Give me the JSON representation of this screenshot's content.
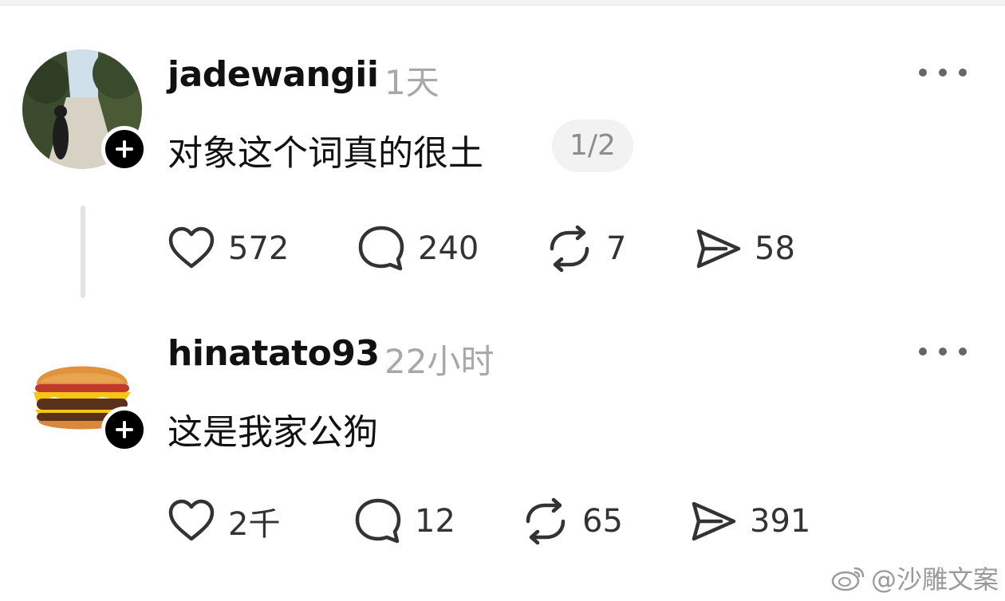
{
  "posts": [
    {
      "username": "jadewangii",
      "time": "1天",
      "content": "对象这个词真的很土",
      "page_badge": "1/2",
      "stats": {
        "likes": "572",
        "comments": "240",
        "reposts": "7",
        "shares": "58"
      }
    },
    {
      "username": "hinatato93",
      "time": "22小时",
      "content": "这是我家公狗",
      "stats": {
        "likes": "2千",
        "comments": "12",
        "reposts": "65",
        "shares": "391"
      }
    }
  ],
  "watermark": {
    "text": "@沙雕文案"
  },
  "icons": {
    "like": "heart-icon",
    "comment": "comment-bubble-icon",
    "repost": "repost-icon",
    "share": "send-icon",
    "more": "more-dots-icon",
    "follow": "plus-icon"
  }
}
